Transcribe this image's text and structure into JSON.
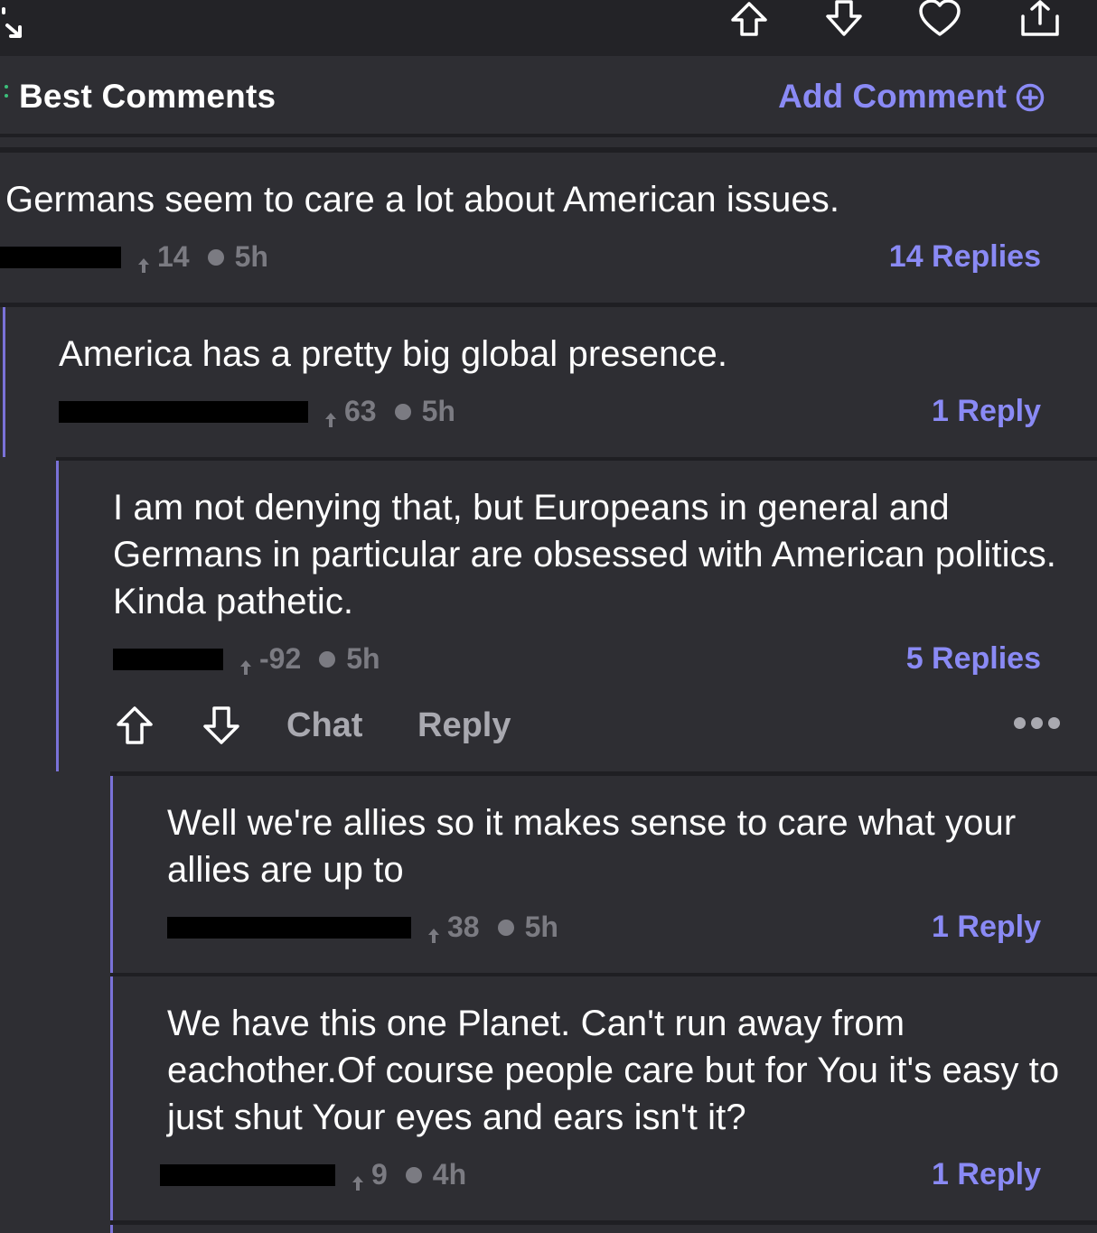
{
  "toolbar": {
    "icons": [
      "expand-icon",
      "upvote-icon",
      "downvote-icon",
      "heart-icon",
      "share-icon"
    ]
  },
  "header": {
    "title": "Best Comments",
    "add_comment_label": "Add Comment",
    "accent_color": "#8a8af5"
  },
  "comments": [
    {
      "text": "Germans seem to care a lot about American issues.",
      "votes": "14",
      "time": "5h",
      "replies": "14 Replies"
    },
    {
      "text": "America has a pretty big global presence.",
      "votes": "63",
      "time": "5h",
      "replies": "1 Reply"
    },
    {
      "text": "I am not denying that, but Europeans in general and Germans in particular are obsessed with American politics. Kinda pathetic.",
      "votes": "-92",
      "time": "5h",
      "replies": "5 Replies"
    },
    {
      "text": "Well we're allies so it makes sense to care what your allies are up to",
      "votes": "38",
      "time": "5h",
      "replies": "1 Reply"
    },
    {
      "text": "We have this one Planet. Can't run away from eachother.Of course people care but for You it's easy to just shut Your eyes and ears isn't it?",
      "votes": "9",
      "time": "4h",
      "replies": "1 Reply"
    }
  ],
  "actions": {
    "chat_label": "Chat",
    "reply_label": "Reply"
  }
}
